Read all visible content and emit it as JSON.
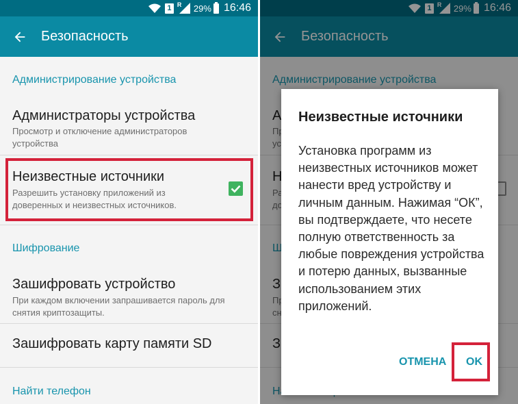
{
  "status_bar": {
    "battery": "29%",
    "time": "16:46",
    "sim": "1",
    "network": "R"
  },
  "app_bar": {
    "title": "Безопасность"
  },
  "sections": {
    "device_admin": {
      "header": "Администрирование устройства",
      "items": [
        {
          "title": "Администраторы устройства",
          "subtitle": "Просмотр и отключение администраторов устройства"
        },
        {
          "title": "Неизвестные источники",
          "subtitle": "Разрешить установку приложений из доверенных и неизвестных источников.",
          "checked": true
        }
      ]
    },
    "encryption": {
      "header": "Шифрование",
      "items": [
        {
          "title": "Зашифровать устройство",
          "subtitle": "При каждом включении запрашивается пароль для снятия криптозащиты."
        },
        {
          "title": "Зашифровать карту памяти SD"
        }
      ]
    },
    "find_phone": {
      "header": "Найти телефон"
    }
  },
  "dialog": {
    "title": "Неизвестные источники",
    "message": "Установка программ из неизвестных источников может нанести вред устройству и личным данным. Нажимая “ОК”, вы подтверждаете, что несете полную ответственность за любые повреждения устройства и потерю данных, вызванные использованием этих приложений.",
    "cancel_label": "ОТМЕНА",
    "ok_label": "OK"
  },
  "colors": {
    "status_bar": "#006c82",
    "app_bar": "#0b8aa3",
    "accent": "#1894ad",
    "checkbox": "#3fb35f",
    "highlight": "#d4223a"
  }
}
